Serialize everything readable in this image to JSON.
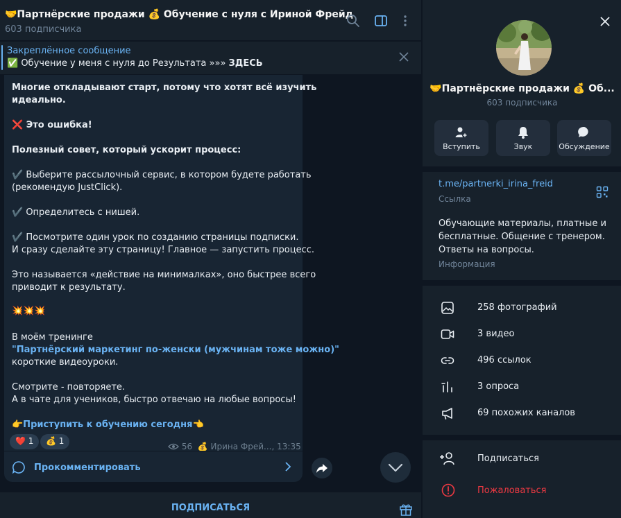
{
  "chat": {
    "title": "🤝Партнёрские продажи 💰 Обучение с нуля с Ириной Фрейд",
    "subtitle": "603 подписчика",
    "pinned": {
      "title": "Закреплённое сообщение",
      "text": "✅ Обучение у меня с нуля до Результата »»» ",
      "text_bold": "ЗДЕСЬ"
    },
    "message": {
      "lines": [
        "Многие откладывают старт, потому что хотят всё изучить",
        "идеально.",
        "❌ Это ошибка!",
        "Полезный совет, который ускорит процесс:",
        "✔️ Выберите рассылочный сервис, в котором будете работать",
        "(рекомендую JustClick).",
        "✔️ Определитесь с нишей.",
        "✔️ Посмотрите один урок по созданию страницы подписки.",
        "И сразу сделайте эту страницу! Главное — запустить процесс.",
        "Это называется «действие на минималках», оно быстрее всего",
        "приводит к результату.",
        "💥💥💥",
        "В моём тренинге",
        "\"Партнёрский маркетинг по-женски (мужчинам тоже можно)\"",
        "короткие видеоуроки.",
        "Смотрите - повторяете.",
        "А в чате для учеников, быстро отвечаю на любые вопросы!",
        "👉Приступить к обучению сегодня👈"
      ],
      "reactions": [
        {
          "emoji": "❤️",
          "count": "1"
        },
        {
          "emoji": "💰",
          "count": "1"
        }
      ],
      "views": "56",
      "author": "💰 Ирина Фрей...",
      "time": "13:35",
      "comment_label": "Прокомментировать"
    },
    "subscribe_label": "ПОДПИСАТЬСЯ"
  },
  "info": {
    "title": "🤝Партнёрские продажи 💰 Об...",
    "subtitle": "603 подписчика",
    "actions": {
      "join": "Вступить",
      "sound": "Звук",
      "discuss": "Обсуждение"
    },
    "link": "t.me/partnerki_irina_freid",
    "link_caption": "Ссылка",
    "description": [
      "Обучающие материалы, платные и",
      "бесплатные. Общение с тренером.",
      "Ответы на вопросы."
    ],
    "description_caption": "Информация",
    "media": [
      {
        "icon": "photo-icon",
        "label": "258 фотографий"
      },
      {
        "icon": "video-icon",
        "label": "3 видео"
      },
      {
        "icon": "link-icon",
        "label": "496 ссылок"
      },
      {
        "icon": "poll-icon",
        "label": "3 опроса"
      },
      {
        "icon": "megaphone-icon",
        "label": "69 похожих каналов"
      }
    ],
    "subscribe_row": "Подписаться",
    "report_row": "Пожаловаться"
  },
  "colors": {
    "accent": "#6ab3f3",
    "danger": "#ec3942",
    "panel": "#17212b",
    "background": "#0e1621",
    "bubble": "#182533"
  }
}
